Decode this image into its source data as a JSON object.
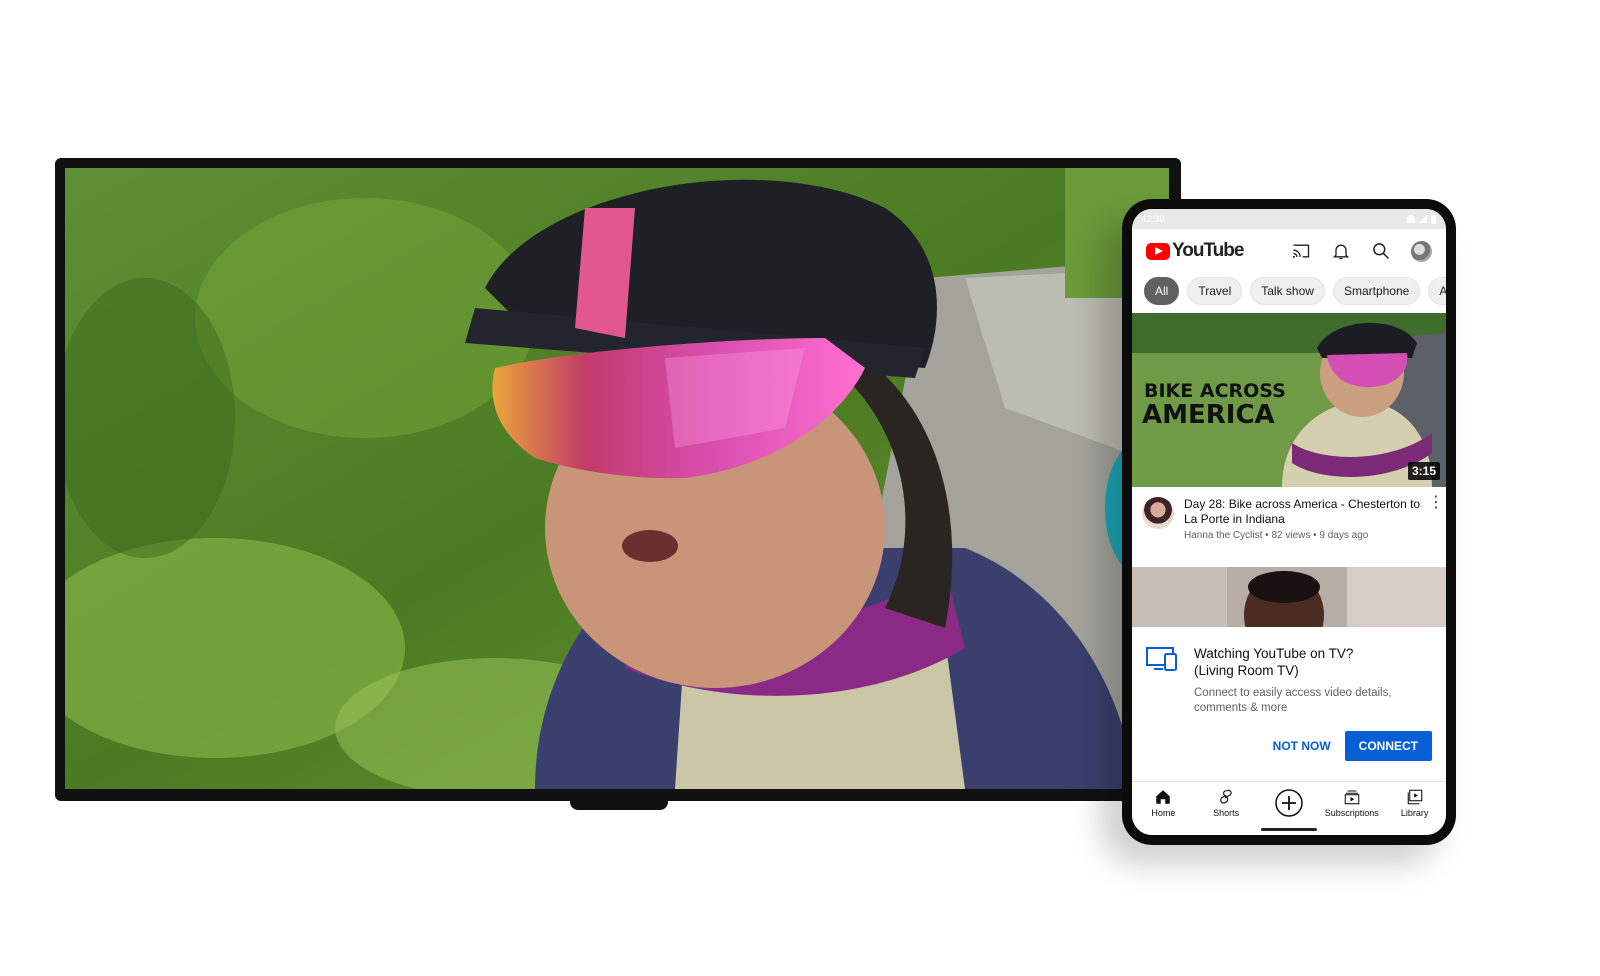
{
  "tv": {
    "content": "cyclist video playing full screen"
  },
  "phone": {
    "status_time": "12:30",
    "app": {
      "logo_text": "YouTube",
      "icons": [
        "cast-icon",
        "bell-icon",
        "search-icon",
        "account-avatar"
      ]
    },
    "chips": [
      {
        "label": "All",
        "active": true
      },
      {
        "label": "Travel",
        "active": false
      },
      {
        "label": "Talk show",
        "active": false
      },
      {
        "label": "Smartphone",
        "active": false
      },
      {
        "label": "Ar",
        "active": false
      }
    ],
    "video": {
      "thumbnail_text_line1": "BIKE ACROSS",
      "thumbnail_text_line2": "AMERICA",
      "duration": "3:15",
      "title": "Day 28: Bike across America - Chesterton to La Porte in Indiana",
      "channel": "Hanna the Cyclist",
      "views": "82 views",
      "age": "9 days ago",
      "separator": " • "
    },
    "prompt": {
      "title_line1": "Watching YouTube on TV?",
      "title_line2": "(Living Room TV)",
      "description": "Connect to easily access video details, comments & more",
      "not_now_label": "NOT NOW",
      "connect_label": "CONNECT"
    },
    "bottom_nav": {
      "home": "Home",
      "shorts": "Shorts",
      "subscriptions": "Subscriptions",
      "library": "Library"
    }
  },
  "colors": {
    "youtube_red": "#ff0000",
    "action_blue": "#065fd4",
    "chip_active": "#606060"
  }
}
